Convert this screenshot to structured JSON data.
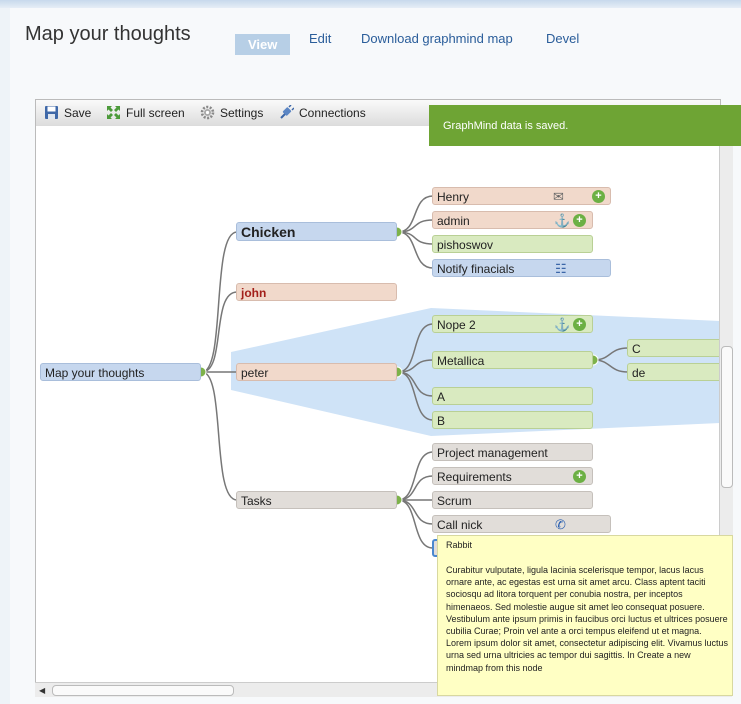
{
  "header": {
    "title": "Map your thoughts",
    "tabs": [
      {
        "label": "View",
        "active": true
      },
      {
        "label": "Edit"
      },
      {
        "label": "Download graphmind map"
      },
      {
        "label": "Devel"
      }
    ]
  },
  "toolbar": {
    "save": "Save",
    "fullscreen": "Full screen",
    "settings": "Settings",
    "connections": "Connections"
  },
  "notice": "GraphMind data is saved.",
  "nodes": {
    "root": "Map your thoughts",
    "chicken": "Chicken",
    "john": "john",
    "peter": "peter",
    "tasks": "Tasks",
    "henry": "Henry",
    "admin": "admin",
    "pishoswov": "pishoswov",
    "notify": "Notify finacials",
    "nope2": "Nope 2",
    "metallica": "Metallica",
    "a": "A",
    "b": "B",
    "c": "C",
    "de": "de",
    "project": "Project management",
    "requirements": "Requirements",
    "scrum": "Scrum",
    "callnick": "Call nick"
  },
  "tooltip": {
    "title": "Rabbit",
    "body": "Curabitur vulputate, ligula lacinia scelerisque tempor, lacus lacus ornare ante, ac egestas est urna sit amet arcu. Class aptent taciti sociosqu ad litora torquent per conubia nostra, per inceptos himenaeos. Sed molestie augue sit amet leo consequat posuere. Vestibulum ante ipsum primis in faucibus orci luctus et ultrices posuere cubilia Curae; Proin vel ante a orci tempus eleifend ut et magna. Lorem ipsum dolor sit amet, consectetur adipiscing elit. Vivamus luctus urna sed urna ultricies ac tempor dui sagittis. In Create a new mindmap from this node"
  },
  "colors": {
    "notice": "#6ea434",
    "selection": "#cfe3f7",
    "tab_active": "#b7cfe6"
  }
}
